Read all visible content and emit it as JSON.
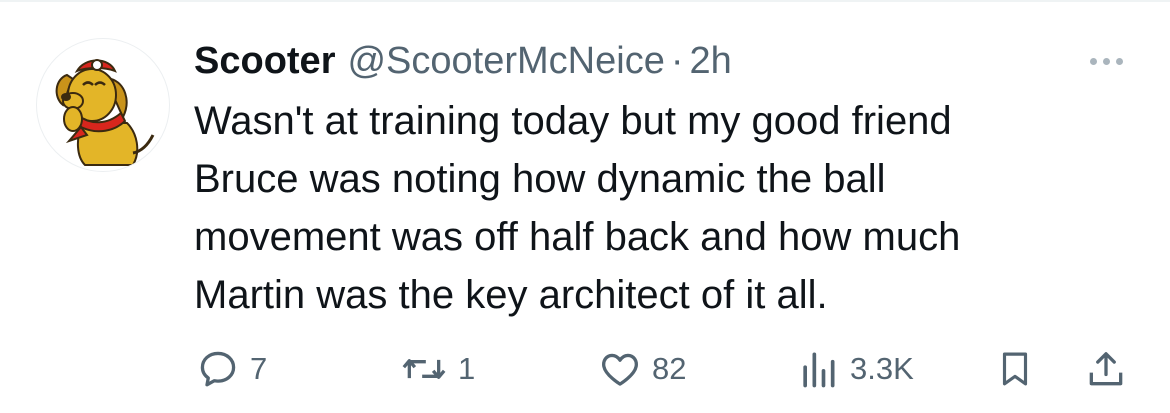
{
  "tweet": {
    "author": {
      "display_name": "Scooter",
      "handle": "@ScooterMcNeice",
      "separator": "·",
      "time": "2h"
    },
    "text_lines": [
      "Wasn't at training today but my good friend",
      "Bruce was noting how dynamic the ball",
      "movement was off half back and how much",
      "Martin was the key architect of it all."
    ],
    "actions": {
      "reply_count": "7",
      "retweet_count": "1",
      "like_count": "82",
      "view_count": "3.3K"
    }
  },
  "icons": {
    "more": "more-horizontal-icon",
    "reply": "reply-icon",
    "retweet": "retweet-icon",
    "like": "heart-icon",
    "views": "bar-chart-icon",
    "bookmark": "bookmark-icon",
    "share": "share-icon"
  },
  "colors": {
    "text": "#0f1419",
    "secondary": "#536471",
    "avatar_dog": "#e3b528",
    "avatar_scarf": "#d8261d"
  }
}
